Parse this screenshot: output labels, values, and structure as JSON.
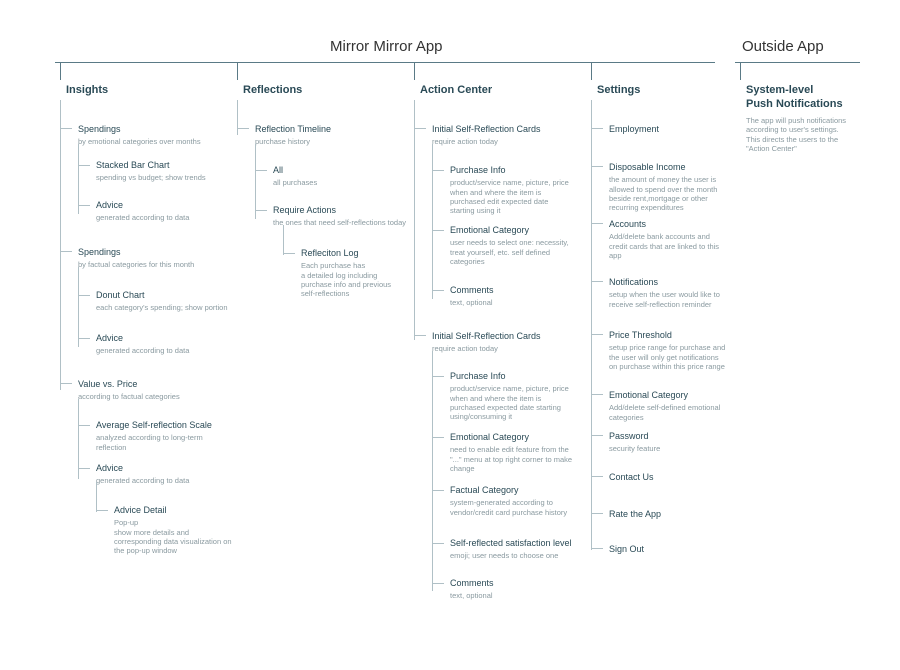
{
  "apps": {
    "main": "Mirror Mirror App",
    "outside": "Outside App"
  },
  "sections": {
    "insights": "Insights",
    "reflections": "Reflections",
    "action_center": "Action Center",
    "settings": "Settings",
    "push": "System-level\nPush Notifications"
  },
  "push_desc": "The app will push notifications according to user's settings. This directs the users to the \"Action Center\"",
  "insights": {
    "spendings1": {
      "t": "Spendings",
      "d": "by emotional categories over months"
    },
    "stacked": {
      "t": "Stacked Bar Chart",
      "d": "spending vs budget; show trends"
    },
    "advice1": {
      "t": "Advice",
      "d": "generated according to data"
    },
    "spendings2": {
      "t": "Spendings",
      "d": "by factual categories for this month"
    },
    "donut": {
      "t": "Donut Chart",
      "d": "each category's spending; show portion"
    },
    "advice2": {
      "t": "Advice",
      "d": "generated according to data"
    },
    "value_price": {
      "t": "Value vs. Price",
      "d": "according to factual categories"
    },
    "avg_scale": {
      "t": "Average Self-reflection Scale",
      "d": "analyzed according to long-term reflection"
    },
    "advice3": {
      "t": "Advice",
      "d": "generated according to data"
    },
    "advice_detail": {
      "t": "Advice Detail",
      "d": "Pop-up\nshow more details and corresponding data visualization on the pop-up window"
    }
  },
  "reflections": {
    "timeline": {
      "t": "Reflection Timeline",
      "d": "purchase history"
    },
    "all": {
      "t": "All",
      "d": "all purchases"
    },
    "require": {
      "t": "Require Actions",
      "d": "the ones that need self-reflections today"
    },
    "log": {
      "t": "Refleciton Log",
      "d": "Each purchase has\na detailed log including purchase info and previous self-reflections"
    }
  },
  "action": {
    "initial1": {
      "t": "Initial Self-Reflection Cards",
      "d": "require action today"
    },
    "pi1": {
      "t": "Purchase Info",
      "d": "product/service name, picture, price when and where the item is purchased edit expected date starting using it"
    },
    "ec1": {
      "t": "Emotional Category",
      "d": "user needs to select one: necessity, treat yourself, etc. self defined categories"
    },
    "comments1": {
      "t": "Comments",
      "d": "text, optional"
    },
    "initial2": {
      "t": "Initial Self-Reflection Cards",
      "d": "require action today"
    },
    "pi2": {
      "t": "Purchase Info",
      "d": "product/service name, picture, price when and where the item is purchased expected date starting using/consuming it"
    },
    "ec2": {
      "t": "Emotional Category",
      "d": "need to enable edit feature from the \"...\" menu at top right corner to make change"
    },
    "fc": {
      "t": "Factual Category",
      "d": "system-generated according to vendor/credit card purchase history"
    },
    "ssl": {
      "t": "Self-reflected satisfaction level",
      "d": "emoji; user needs to choose one"
    },
    "comments2": {
      "t": "Comments",
      "d": "text, optional"
    }
  },
  "settings": {
    "employment": {
      "t": "Employment",
      "d": ""
    },
    "income": {
      "t": "Disposable Income",
      "d": "the amount of money the user is allowed to spend over the month beside rent,mortgage or other recurring expenditures"
    },
    "accounts": {
      "t": "Accounts",
      "d": "Add/delete bank accounts and credit cards that are linked to this app"
    },
    "notifications": {
      "t": "Notifications",
      "d": "setup when the user would like to receive self-reflection reminder"
    },
    "price_threshold": {
      "t": "Price Threshold",
      "d": "setup price range for purchase and the user will only get notifications on purchase within this price range"
    },
    "emo_cat": {
      "t": "Emotional Category",
      "d": "Add/delete self-defined emotional categories"
    },
    "password": {
      "t": "Password",
      "d": "security feature"
    },
    "contact": {
      "t": "Contact Us",
      "d": ""
    },
    "rate": {
      "t": "Rate the App",
      "d": ""
    },
    "signout": {
      "t": "Sign Out",
      "d": ""
    }
  }
}
